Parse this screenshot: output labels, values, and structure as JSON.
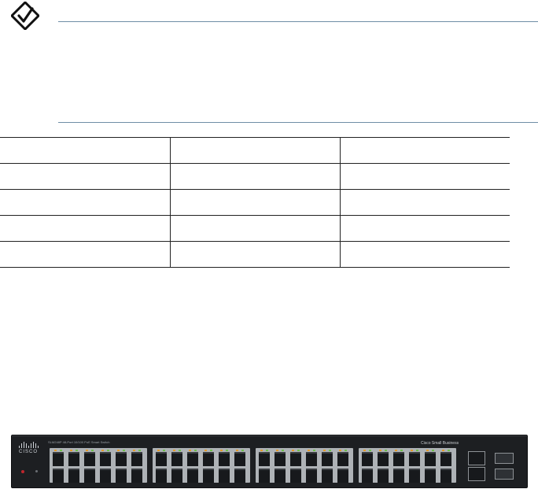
{
  "note": {
    "icon": "checkmark-note-icon",
    "rule_color": "#6f8ea6"
  },
  "table": {
    "rows": [
      [
        "",
        "",
        ""
      ],
      [
        "",
        "",
        ""
      ],
      [
        "",
        "",
        ""
      ],
      [
        "",
        "",
        ""
      ],
      [
        "",
        "",
        ""
      ]
    ]
  },
  "device": {
    "logo_text": "CISCO",
    "model_text": "SLM248P 48-Port 10/100 PoE Smart Switch",
    "brand_text": "Cisco Small Business"
  }
}
